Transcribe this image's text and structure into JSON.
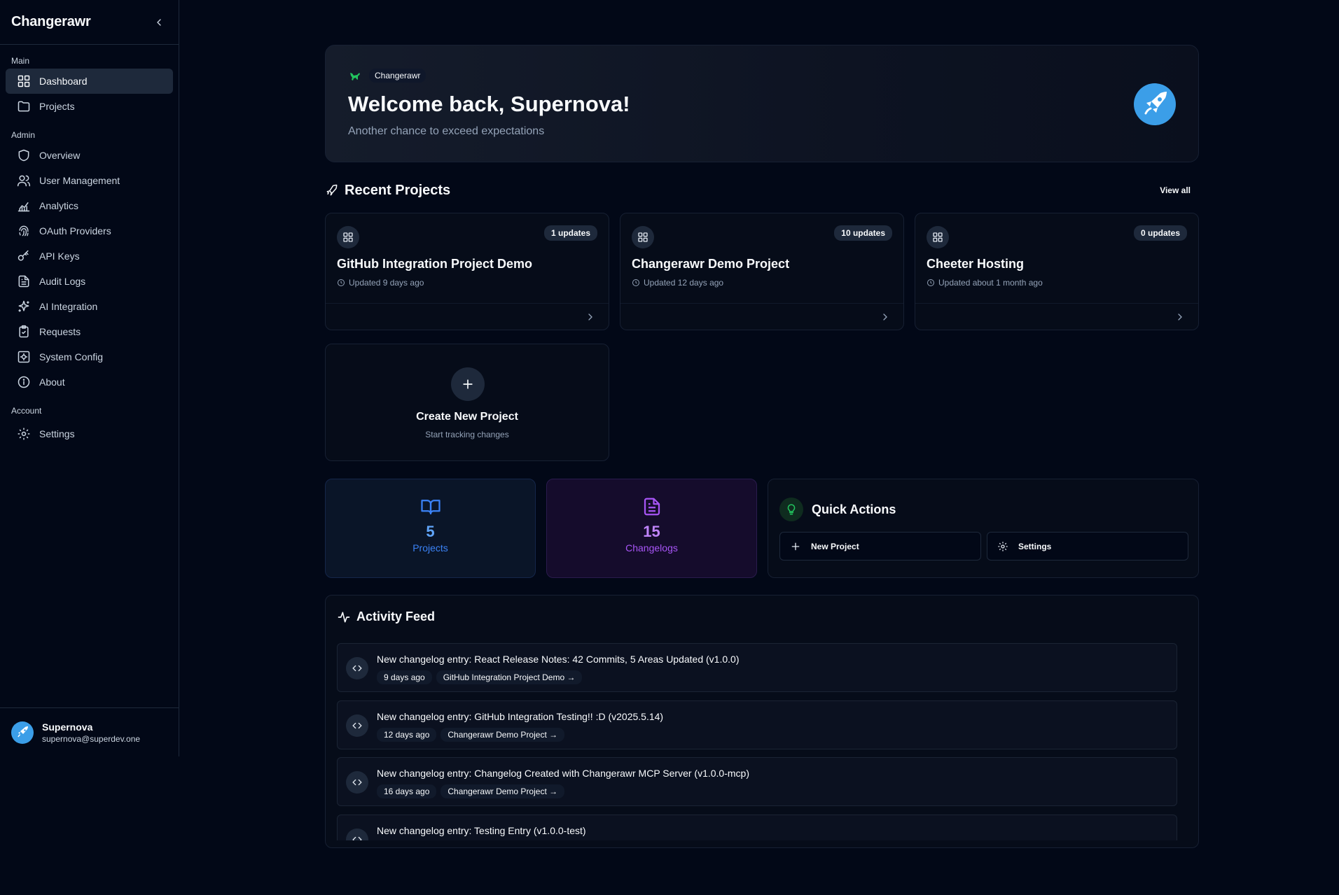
{
  "sidebar": {
    "brand": "Changerawr",
    "sections": [
      {
        "label": "Main"
      },
      {
        "label": "Admin"
      },
      {
        "label": "Account"
      }
    ],
    "items": {
      "dashboard": "Dashboard",
      "projects": "Projects",
      "overview": "Overview",
      "user_management": "User Management",
      "analytics": "Analytics",
      "oauth": "OAuth Providers",
      "api_keys": "API Keys",
      "audit_logs": "Audit Logs",
      "ai_integration": "AI Integration",
      "requests": "Requests",
      "system_config": "System Config",
      "about": "About",
      "settings": "Settings"
    },
    "user": {
      "name": "Supernova",
      "email": "supernova@superdev.one"
    }
  },
  "hero": {
    "badge": "Changerawr",
    "title": "Welcome back, Supernova!",
    "subtitle": "Another chance to exceed expectations"
  },
  "recent": {
    "title": "Recent Projects",
    "view_all": "View all",
    "projects": [
      {
        "name": "GitHub Integration Project Demo",
        "updates": "1 updates",
        "updated": "Updated 9 days ago"
      },
      {
        "name": "Changerawr Demo Project",
        "updates": "10 updates",
        "updated": "Updated 12 days ago"
      },
      {
        "name": "Cheeter Hosting",
        "updates": "0 updates",
        "updated": "Updated about 1 month ago"
      }
    ],
    "create": {
      "title": "Create New Project",
      "subtitle": "Start tracking changes"
    }
  },
  "stats": {
    "projects": {
      "value": "5",
      "label": "Projects",
      "color": "#3b82f6"
    },
    "changelogs": {
      "value": "15",
      "label": "Changelogs",
      "color": "#a855f7"
    }
  },
  "quick_actions": {
    "title": "Quick Actions",
    "new_project": "New Project",
    "settings": "Settings"
  },
  "feed": {
    "title": "Activity Feed",
    "items": [
      {
        "text": "New changelog entry: React Release Notes: 42 Commits, 5 Areas Updated (v1.0.0)",
        "time": "9 days ago",
        "project": "GitHub Integration Project Demo →"
      },
      {
        "text": "New changelog entry: GitHub Integration Testing!! :D (v2025.5.14)",
        "time": "12 days ago",
        "project": "Changerawr Demo Project →"
      },
      {
        "text": "New changelog entry: Changelog Created with Changerawr MCP Server (v1.0.0-mcp)",
        "time": "16 days ago",
        "project": "Changerawr Demo Project →"
      },
      {
        "text": "New changelog entry: Testing Entry (v1.0.0-test)",
        "time": "",
        "project": ""
      }
    ]
  }
}
